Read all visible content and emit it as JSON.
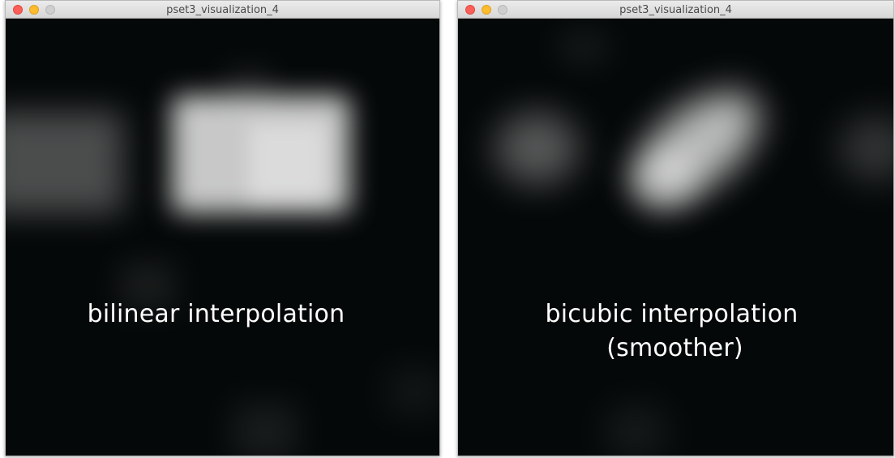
{
  "windows": {
    "left": {
      "title": "pset3_visualization_4",
      "label": "bilinear interpolation"
    },
    "right": {
      "title": "pset3_visualization_4",
      "label_line1": "bicubic interpolation",
      "label_line2": "(smoother)"
    }
  },
  "colors": {
    "canvas_background": "#050808",
    "close": "#fc5f57",
    "minimize": "#fdbb2e",
    "maximize": "#cfcfcf"
  }
}
